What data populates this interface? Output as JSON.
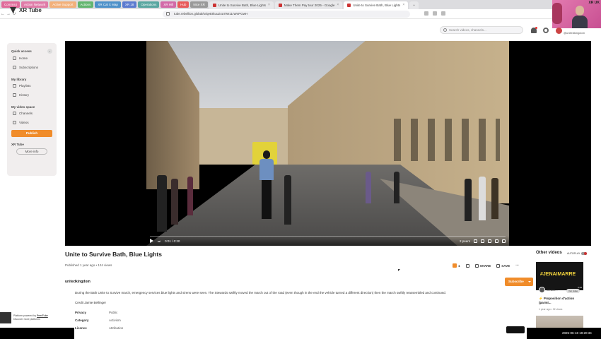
{
  "browser": {
    "bookmarks": [
      {
        "label": "Comms4",
        "color": "#e06b9a"
      },
      {
        "label": "Action Network",
        "color": "#e07ba8"
      },
      {
        "label": "Active Support",
        "color": "#f2b07a"
      },
      {
        "label": "Actions",
        "color": "#63b56f"
      },
      {
        "label": "XR Cal X Map",
        "color": "#4e91c9"
      },
      {
        "label": "XR 18",
        "color": "#5c7bd0"
      },
      {
        "label": "Operations",
        "color": "#59a6a0"
      },
      {
        "label": "XR Hill",
        "color": "#d26aa8"
      },
      {
        "label": "Hub",
        "color": "#e85a5a"
      },
      {
        "label": "Nice XR",
        "color": "#9a9a9a"
      }
    ],
    "tabs": [
      {
        "label": "Unite to Survive Bath, Blue Lights",
        "active": false
      },
      {
        "label": "Make Them Pay tour 2025 - Google",
        "active": false
      },
      {
        "label": "Unite to Survive Bath, Blue Lights",
        "active": true
      }
    ],
    "url": "tube.rebellion.global/w/qeEtkuuZ4a7tW11rW4PGwH"
  },
  "webcam": {
    "label": "XR UK"
  },
  "site": {
    "brand": "XR Tube",
    "search_placeholder": "Search videos, channels...",
    "user_handle": "@unitedkingdom"
  },
  "sidebar": {
    "sections": [
      {
        "title": "Quick access",
        "items": [
          "Home",
          "Subscriptions"
        ]
      },
      {
        "title": "My library",
        "items": [
          "Playlists",
          "History"
        ]
      },
      {
        "title": "My video space",
        "items": [
          "Channels",
          "Videos"
        ]
      }
    ],
    "publish_label": "Publish",
    "xrtube_title": "XR Tube",
    "more_info_label": "More info"
  },
  "player": {
    "time": "0:01 / 0:20",
    "speed": "2 peers"
  },
  "video": {
    "title": "Unite to Survive Bath, Blue Lights",
    "meta": "Published 1 year ago • 124 views",
    "likes": "1",
    "share_label": "SHARE",
    "save_label": "SAVE",
    "more_label": "⋯",
    "channel": "unitedkingdom",
    "subscribe_label": "Subscribe",
    "description": "During the Bath Unite to Survive march, emergency services blue lights and sirens were seen. The Stewards swiftly moved the march out of the road (even though in the end the vehicle turned a different direction) then the march swiftly reassembled and continued.",
    "credit": "Credit Jamie Bellinger",
    "info": [
      {
        "key": "Privacy",
        "value": "Public"
      },
      {
        "key": "Category",
        "value": "Activism"
      },
      {
        "key": "Licence",
        "value": "Attribution"
      }
    ]
  },
  "right": {
    "other_videos_label": "Other videos",
    "autoplay_label": "AUTOPLAY",
    "rec": {
      "thumb_text": "#JENAIMARRE",
      "duration": "0:22",
      "channel": "xrfranc...",
      "tag": "Voir vidéo",
      "title": "⚡ Proposition d'action (parmi...",
      "meta": "1 year ago • 32 views"
    }
  },
  "footer": {
    "peertube_line1": "Platform powered by",
    "peertube_link": "PeerTube",
    "peertube_line2": "Discover more platforms",
    "clock": "2025-06-18  19:20:34"
  }
}
